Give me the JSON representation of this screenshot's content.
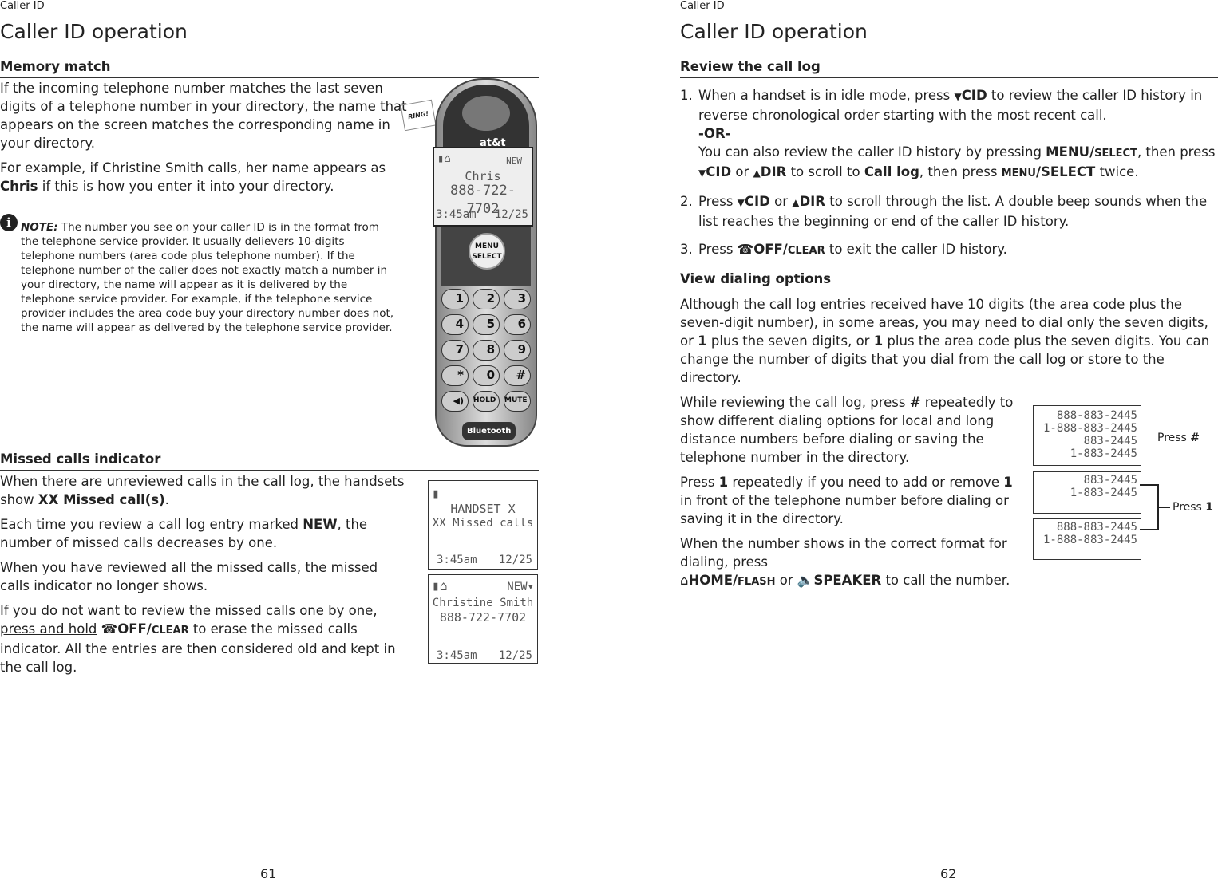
{
  "left": {
    "running_head": "Caller ID",
    "title": "Caller ID operation",
    "page_number": "61",
    "memory": {
      "heading": "Memory match",
      "p1": "If the incoming telephone number matches the last seven digits of a telephone number in your directory, the name that appears on the screen matches the corresponding name in your directory.",
      "p2a": "For example, if Christine Smith calls, her name appears as ",
      "p2b": "Chris",
      "p2c": " if this is how you enter it into your directory.",
      "note_label": "NOTE:",
      "note": " The number you see on your caller ID is in the format from the telephone service provider. It usually delievers 10-digits telephone numbers (area code plus telephone number). If the telephone number of the caller does not exactly match a number in your directory, the name will appear as it is delivered by the telephone service provider. For example, if the telephone service provider includes the area code buy your directory number does not, the name will appear as delivered by the telephone service provider."
    },
    "phone": {
      "ring": "RING!",
      "brand": "at&t",
      "screen": {
        "new": "NEW",
        "name": "Chris",
        "number": "888-722-7702",
        "time": "3:45am",
        "date": "12/25"
      },
      "menu": "MENU",
      "select": "SELECT",
      "keys": [
        "1",
        "2",
        "3",
        "4",
        "5",
        "6",
        "7",
        "8",
        "9",
        "*",
        "0",
        "#"
      ],
      "bottom": [
        "◀)",
        "HOLD",
        "MUTE"
      ],
      "bluetooth": "Bluetooth"
    },
    "missed": {
      "heading": "Missed calls indicator",
      "p1a": "When there are unreviewed calls in the call log, the handsets show ",
      "p1b": "XX Missed call(s)",
      "p1c": ".",
      "p2a": "Each time you review a call log entry marked ",
      "p2b": "NEW",
      "p2c": ", the number of missed calls decreases by one.",
      "p3": "When you have reviewed all the missed calls, the missed calls indicator no longer shows.",
      "p4a": "If you do not want to review the missed calls one by one, ",
      "p4b": "press and hold",
      "p4c": "OFF/",
      "p4d": "CLEAR",
      "p4e": " to erase the missed calls indicator. All the entries are then considered old and kept in the call log.",
      "screen1": {
        "l1": "HANDSET X",
        "l2": "XX Missed calls",
        "time": "3:45am",
        "date": "12/25"
      },
      "screen2": {
        "new": "NEW",
        "l1": "Christine Smith",
        "l2": "888-722-7702",
        "time": "3:45am",
        "date": "12/25"
      }
    }
  },
  "right": {
    "running_head": "Caller ID",
    "title": "Caller ID operation",
    "page_number": "62",
    "review": {
      "heading": "Review the call log",
      "s1": {
        "n": "1.",
        "a": "When a handset is in idle mode, press ",
        "b": "CID",
        "c": " to review the caller ID history in reverse chronological order starting with the most recent call.",
        "or": "-OR-",
        "d": "You can also review the caller ID history by pressing ",
        "e": "MENU/",
        "f": "SELECT",
        "g": ", then press ",
        "h": "CID",
        "i": " or ",
        "j": "DIR",
        "k": " to scroll to ",
        "l": "Call log",
        "m": ", then press ",
        "o": "MENU",
        "p": "/SELECT",
        "q": " twice."
      },
      "s2": {
        "n": "2.",
        "a": "Press ",
        "b": "CID",
        "c": " or ",
        "d": "DIR",
        "e": " to scroll through the list. A double beep sounds when the list reaches the beginning or end of the caller ID history."
      },
      "s3": {
        "n": "3.",
        "a": "Press ",
        "b": "OFF/",
        "c": "CLEAR",
        "d": " to exit the caller ID history."
      }
    },
    "dialing": {
      "heading": "View dialing options",
      "p1a": "Although the call log entries received have 10 digits (the area code plus the seven-digit number), in some areas, you may need to dial only the seven digits, or ",
      "p1b": "1",
      "p1c": " plus the seven digits, or ",
      "p1d": "1",
      "p1e": " plus the area code plus the seven digits. You can change the number of digits that you dial from the call log or store to the directory.",
      "p2a": "While reviewing the call log, press ",
      "p2b": "#",
      "p2c": " repeatedly to show different dialing options for local and long distance numbers before dialing or saving the telephone number in the directory.",
      "p3a": "Press ",
      "p3b": "1",
      "p3c": " repeatedly if you need to add or remove ",
      "p3d": "1",
      "p3e": " in front of the telephone number before dialing or saving it in the directory.",
      "p4a": "When the number shows in the correct format for dialing, press",
      "p4b": "HOME/",
      "p4c": "FLASH",
      "p4d": " or ",
      "p4e": "SPEAKER",
      "p4f": " to call the number.",
      "box1": [
        "888-883-2445",
        "1-888-883-2445",
        "883-2445",
        "1-883-2445"
      ],
      "box2": [
        "883-2445",
        "1-883-2445"
      ],
      "box3": [
        "888-883-2445",
        "1-888-883-2445"
      ],
      "press_hash": "Press ",
      "hash": "#",
      "press_one": "Press ",
      "one": "1"
    }
  }
}
